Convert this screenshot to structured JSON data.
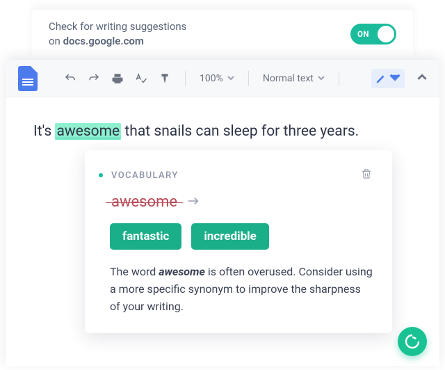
{
  "banner": {
    "line1": "Check for writing suggestions",
    "line2_prefix": "on ",
    "domain": "docs.google.com",
    "toggle_label": "ON"
  },
  "toolbar": {
    "zoom": "100%",
    "style": "Normal text"
  },
  "document": {
    "before": "It's ",
    "highlighted": "awesome",
    "after": " that snails can sleep for three years."
  },
  "card": {
    "category": "VOCABULARY",
    "struck_word": "awesome",
    "suggestions": [
      "fantastic",
      "incredible"
    ],
    "explain_pre": "The word ",
    "explain_word": "awesome",
    "explain_post": " is often overused. Consider using a more specific synonym to improve the sharpness of your writing."
  }
}
